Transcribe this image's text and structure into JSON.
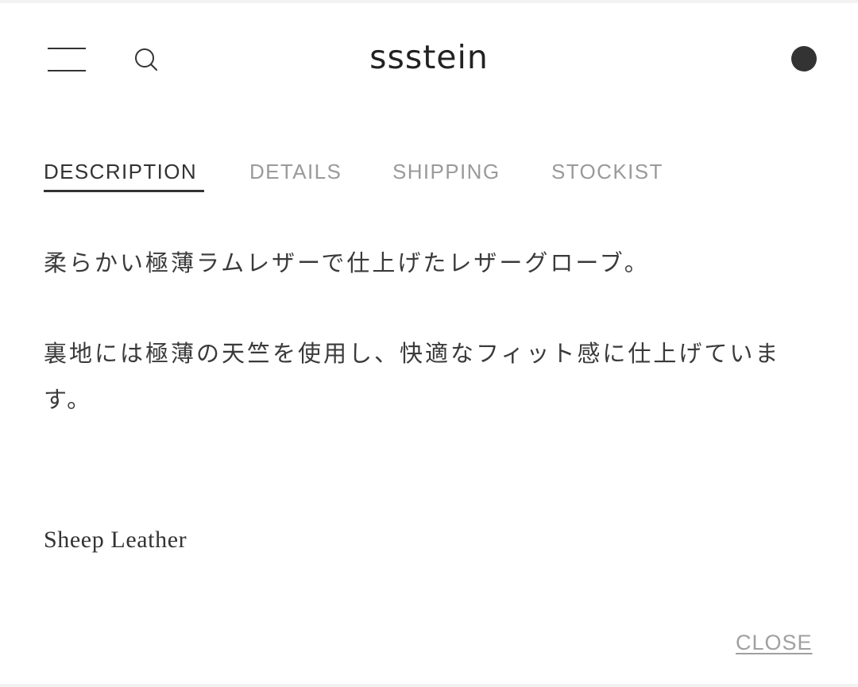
{
  "header": {
    "brand": "ssstein",
    "icons": {
      "menu": "hamburger-menu-icon",
      "search": "search-icon",
      "cart": "cart-dot-icon"
    }
  },
  "tabs": [
    {
      "label": "DESCRIPTION",
      "active": true
    },
    {
      "label": "DETAILS",
      "active": false
    },
    {
      "label": "SHIPPING",
      "active": false
    },
    {
      "label": "STOCKIST",
      "active": false
    }
  ],
  "description": {
    "paragraphs": [
      "柔らかい極薄ラムレザーで仕上げたレザーグローブ。",
      "裏地には極薄の天竺を使用し、快適なフィット感に仕上げています。"
    ],
    "material": "Sheep Leather"
  },
  "close_label": "CLOSE",
  "colors": {
    "text_primary": "#333333",
    "text_muted": "#9a9a9a",
    "background": "#ffffff"
  }
}
